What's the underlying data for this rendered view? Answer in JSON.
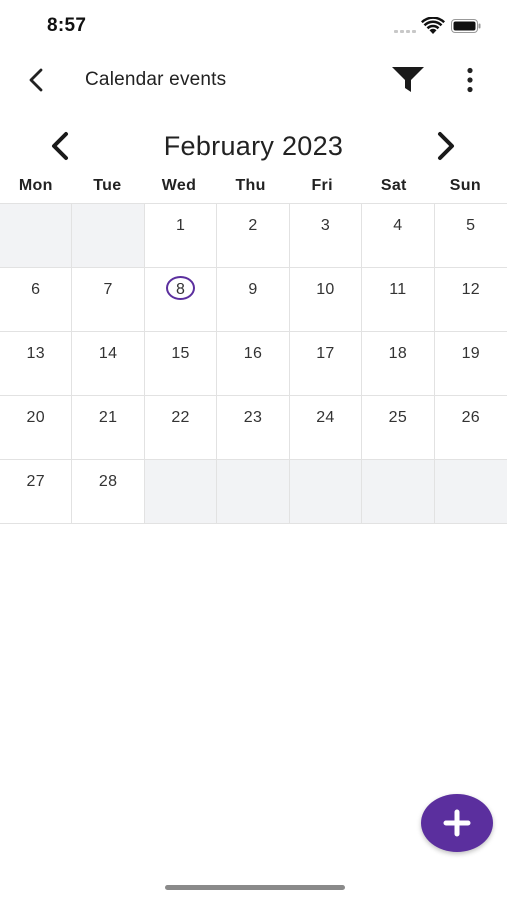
{
  "status_bar": {
    "time": "8:57",
    "icons": [
      "signal-dots-icon",
      "wifi-icon",
      "battery-icon"
    ]
  },
  "app_bar": {
    "title": "Calendar events",
    "back_icon": "chevron-left-icon",
    "filter_icon": "filter-funnel-icon",
    "more_icon": "more-vertical-icon"
  },
  "calendar": {
    "month_label": "February 2023",
    "prev_icon": "chevron-left-icon",
    "next_icon": "chevron-right-icon",
    "weekdays": [
      "Mon",
      "Tue",
      "Wed",
      "Thu",
      "Fri",
      "Sat",
      "Sun"
    ],
    "selected_day": "8",
    "weeks": [
      [
        "",
        "",
        "1",
        "2",
        "3",
        "4",
        "5"
      ],
      [
        "6",
        "7",
        "8",
        "9",
        "10",
        "11",
        "12"
      ],
      [
        "13",
        "14",
        "15",
        "16",
        "17",
        "18",
        "19"
      ],
      [
        "20",
        "21",
        "22",
        "23",
        "24",
        "25",
        "26"
      ],
      [
        "27",
        "28",
        "",
        "",
        "",
        "",
        ""
      ]
    ]
  },
  "fab": {
    "icon": "plus-icon"
  },
  "colors": {
    "accent": "#5b2f9e",
    "empty_cell": "#f2f3f5",
    "grid_line": "#e2e2e2"
  }
}
